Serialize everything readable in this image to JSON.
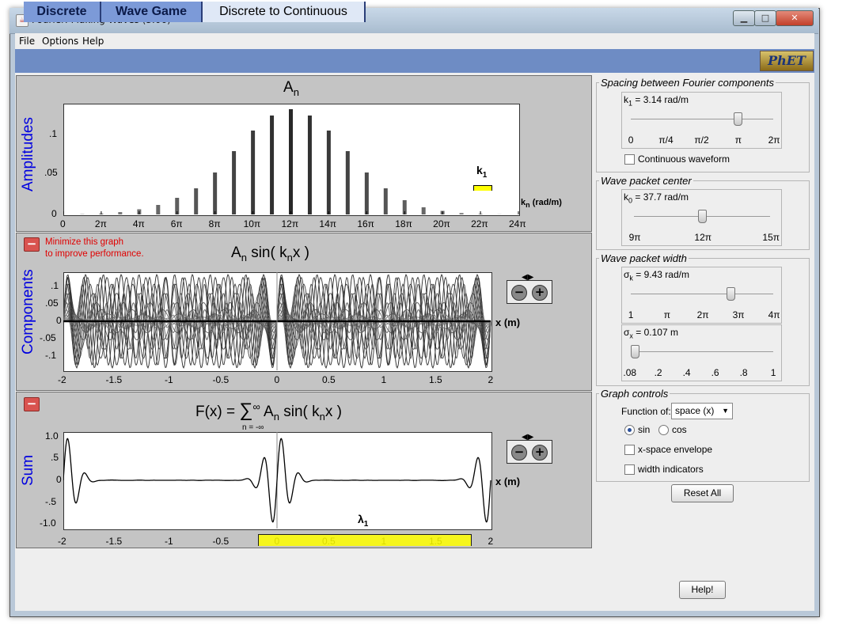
{
  "window": {
    "title": "Fourier: Making Waves (3.06)",
    "min_glyph": "▁",
    "max_glyph": "□",
    "close_glyph": "✕",
    "app_icon_glyph": "☕"
  },
  "menu": [
    "File",
    "Options",
    "Help"
  ],
  "tabs": [
    {
      "label": "Discrete",
      "active": false
    },
    {
      "label": "Wave Game",
      "active": false
    },
    {
      "label": "Discrete to Continuous",
      "active": true
    }
  ],
  "logo": "PhET",
  "amplitudes": {
    "title": "A",
    "title_sub": "n",
    "ylabel": "Amplitudes",
    "yticks": [
      ".1",
      ".05",
      "0"
    ],
    "xticks": [
      "0",
      "2π",
      "4π",
      "6π",
      "8π",
      "10π",
      "12π",
      "14π",
      "16π",
      "18π",
      "20π",
      "22π",
      "24π"
    ],
    "xunit": "k",
    "xunit_sub": "n",
    "xunit_tail": "(rad/m)",
    "k1_label": "k",
    "k1_sub": "1"
  },
  "components": {
    "minimize_text": [
      "Minimize this graph",
      "to improve performance."
    ],
    "minimize_glyph": "−",
    "title_parts": [
      "A",
      "n",
      " sin( k",
      "n",
      "x )"
    ],
    "ylabel": "Components",
    "yticks": [
      ".1",
      ".05",
      "0",
      "-.05",
      "-.1"
    ],
    "xticks": [
      "-2",
      "-1.5",
      "-1",
      "-0.5",
      "0",
      "0.5",
      "1",
      "1.5",
      "2"
    ],
    "xunit": "x (m)",
    "zoom_minus": "−",
    "zoom_plus": "+"
  },
  "sum": {
    "minimize_glyph": "−",
    "formula_parts": [
      "F(x) = ",
      "∑",
      "∞",
      "n = -∞",
      "A",
      "n",
      " sin( k",
      "n",
      "x )"
    ],
    "ylabel": "Sum",
    "yticks": [
      "1.0",
      ".5",
      "0",
      "-.5",
      "-1.0"
    ],
    "xticks": [
      "-2",
      "-1.5",
      "-1",
      "-0.5",
      "0",
      "0.5",
      "1",
      "1.5",
      "2"
    ],
    "xunit": "x (m)",
    "lambda_label": "λ",
    "lambda_sub": "1",
    "zoom_minus": "−",
    "zoom_plus": "+"
  },
  "controls": {
    "spacing": {
      "title": "Spacing between Fourier components",
      "label": "k",
      "label_sub": "1",
      "value_text": " = 3.14 rad/m",
      "ticks": [
        "0",
        "π/4",
        "π/2",
        "π",
        "2π"
      ],
      "value_fraction": 0.75,
      "continuous_label": "Continuous waveform",
      "continuous_checked": false
    },
    "center": {
      "title": "Wave packet center",
      "label": "k",
      "label_sub": "0",
      "value_text": " = 37.7 rad/m",
      "ticks": [
        "9π",
        "12π",
        "15π"
      ],
      "value_fraction": 0.5
    },
    "width": {
      "title": "Wave packet width",
      "sigma_k_label": "σ",
      "sigma_k_sub": "k",
      "sigma_k_text": " = 9.43 rad/m",
      "sigma_k_ticks": [
        "1",
        "π",
        "2π",
        "3π",
        "4π"
      ],
      "sigma_k_fraction": 0.7,
      "sigma_x_label": "σ",
      "sigma_x_sub": "x",
      "sigma_x_text": " = 0.107 m",
      "sigma_x_ticks": [
        ".08",
        ".2",
        ".4",
        ".6",
        ".8",
        "1"
      ],
      "sigma_x_fraction": 0.03
    },
    "graph": {
      "title": "Graph controls",
      "function_label": "Function of:",
      "function_value": "space (x)",
      "sin_label": "sin",
      "cos_label": "cos",
      "selected": "sin",
      "envelope_label": "x-space envelope",
      "envelope_checked": false,
      "width_ind_label": "width indicators",
      "width_ind_checked": false
    },
    "reset_label": "Reset All",
    "help_label": "Help!"
  },
  "colors": {
    "tabstrip": "#6e8cc4",
    "ylabel": "#0000e0",
    "k1_marker": "#ffff00",
    "minimize": "#d9534f"
  },
  "chart_data": [
    {
      "type": "bar",
      "title": "An",
      "ylabel": "Amplitudes",
      "xlabel": "kn (rad/m)",
      "x": [
        3.14,
        6.28,
        9.42,
        12.57,
        15.71,
        18.85,
        21.99,
        25.13,
        28.27,
        31.42,
        34.56,
        37.7,
        40.84,
        43.98,
        47.12,
        50.27,
        53.41,
        56.55,
        59.69,
        62.83,
        65.97,
        69.12,
        72.26
      ],
      "values": [
        0.0004,
        0.0012,
        0.003,
        0.0065,
        0.012,
        0.021,
        0.033,
        0.053,
        0.08,
        0.106,
        0.125,
        0.133,
        0.125,
        0.106,
        0.08,
        0.053,
        0.033,
        0.018,
        0.009,
        0.0045,
        0.0018,
        0.0007,
        0.0002
      ],
      "ylim": [
        0,
        0.14
      ],
      "xlim": [
        0,
        75.4
      ]
    },
    {
      "type": "line",
      "title": "An sin( knx )",
      "ylabel": "Components",
      "xlabel": "x (m)",
      "series_rule": "An sin(kn x) for each harmonic above",
      "xlim": [
        -2,
        2
      ],
      "ylim": [
        -0.14,
        0.14
      ]
    },
    {
      "type": "line",
      "title": "F(x) = Σ An sin( knx )",
      "ylabel": "Sum",
      "xlabel": "x (m)",
      "xlim": [
        -2,
        2
      ],
      "ylim": [
        -1.1,
        1.1
      ]
    }
  ]
}
